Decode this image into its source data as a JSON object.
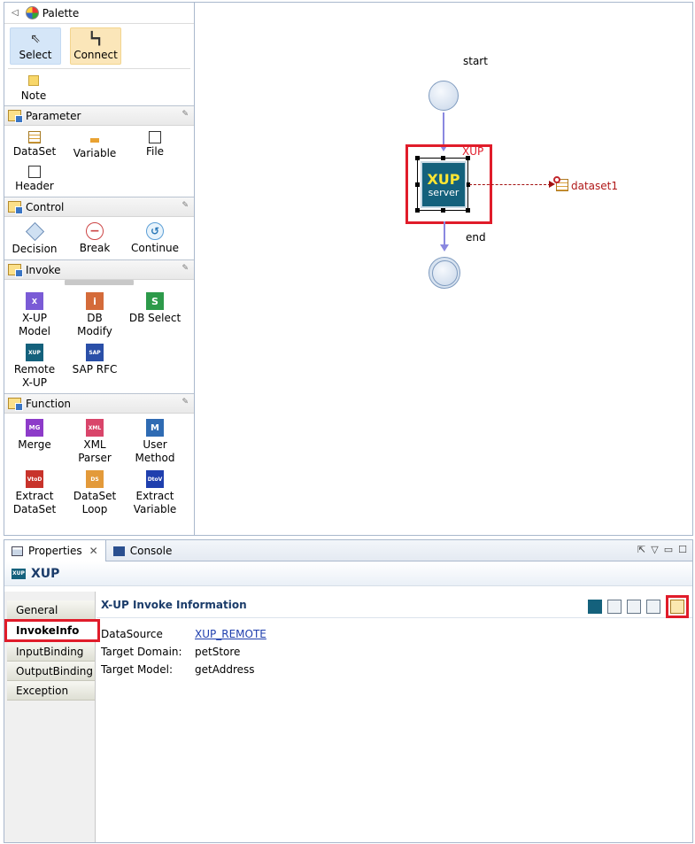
{
  "palette": {
    "title": "Palette",
    "tools": [
      {
        "label": "Select",
        "icon": "arrow-cursor-icon"
      },
      {
        "label": "Connect",
        "icon": "connector-icon"
      }
    ],
    "note_label": "Note",
    "drawers": [
      {
        "title": "Parameter",
        "items": [
          "DataSet",
          "Variable",
          "File",
          "Header"
        ]
      },
      {
        "title": "Control",
        "items": [
          "Decision",
          "Break",
          "Continue"
        ]
      },
      {
        "title": "Invoke",
        "items": [
          "X-UP\nModel",
          "DB\nModify",
          "DB Select",
          "Remote\nX-UP",
          "SAP RFC"
        ]
      },
      {
        "title": "Function",
        "items": [
          "Merge",
          "XML\nParser",
          "User\nMethod",
          "Extract\nDataSet",
          "DataSet\nLoop",
          "Extract\nVariable"
        ]
      }
    ],
    "icon_glyphs": {
      "xup_model": "X",
      "db_modify": "i",
      "db_select": "S",
      "remote_xup": "XUP",
      "sap_rfc": "SAP",
      "merge": "MG",
      "xml_parser": "XML",
      "user_method": "M",
      "extract_dataset": "VtoD",
      "dataset_loop": "DS",
      "extract_variable": "DtoV"
    }
  },
  "canvas": {
    "start_label": "start",
    "end_label": "end",
    "xup_tag": "XUP",
    "xup_node_title": "XUP",
    "xup_node_subtitle": "server",
    "dataset_label": "dataset1"
  },
  "properties": {
    "tabs": [
      "Properties",
      "Console"
    ],
    "header_title": "XUP",
    "side_tabs": [
      "General",
      "InvokeInfo",
      "InputBinding",
      "OutputBinding",
      "Exception"
    ],
    "active_side_tab": "InvokeInfo",
    "section_title": "X-UP Invoke Information",
    "fields": [
      {
        "key": "DataSource",
        "value": "XUP_REMOTE",
        "link": true
      },
      {
        "key": "Target Domain:",
        "value": "petStore",
        "link": false
      },
      {
        "key": "Target Model:",
        "value": "getAddress",
        "link": false
      }
    ]
  },
  "colors": {
    "highlight": "#e01c2a",
    "xup_node": "#14617c",
    "connector": "#8a88e0",
    "link": "#1f3fae"
  }
}
